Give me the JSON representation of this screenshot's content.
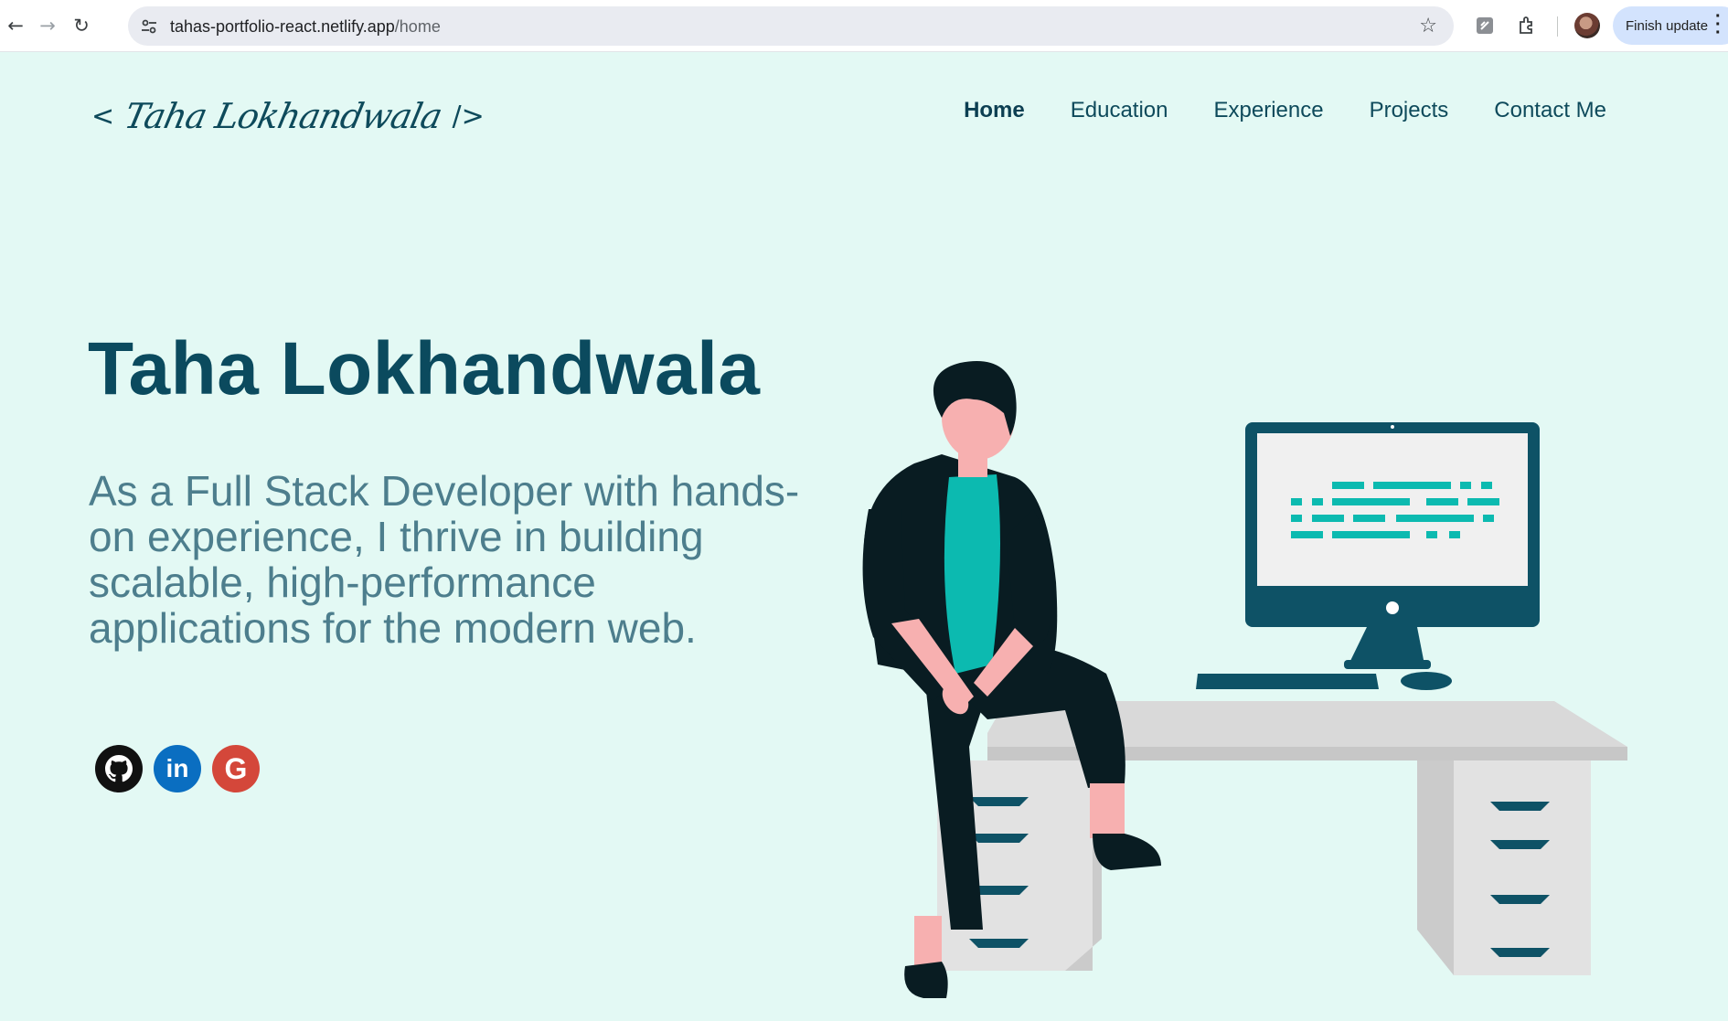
{
  "browser": {
    "url_host": "tahas-portfolio-react.netlify.app",
    "url_path": "/home",
    "update_label": "Finish update"
  },
  "site": {
    "logo_open": "<",
    "logo_text": "Taha Lokhandwala",
    "logo_close": "/>",
    "nav": [
      {
        "label": "Home",
        "active": true
      },
      {
        "label": "Education"
      },
      {
        "label": "Experience"
      },
      {
        "label": "Projects"
      },
      {
        "label": "Contact Me"
      }
    ],
    "name": "Taha Lokhandwala",
    "description": "As a Full Stack Developer with hands-on experience, I thrive in building scalable, high-performance applications for the modern web.",
    "socials": [
      {
        "icon": "github-icon",
        "color": "#111111"
      },
      {
        "icon": "linkedin-icon",
        "label": "in",
        "color": "#0a6ec1"
      },
      {
        "icon": "google-icon",
        "label": "G",
        "color": "#d4473a"
      }
    ]
  },
  "colors": {
    "background": "#e3f9f4",
    "primary": "#0b4a5e",
    "accent": "#0cbab0",
    "description": "#4d7e8d"
  }
}
